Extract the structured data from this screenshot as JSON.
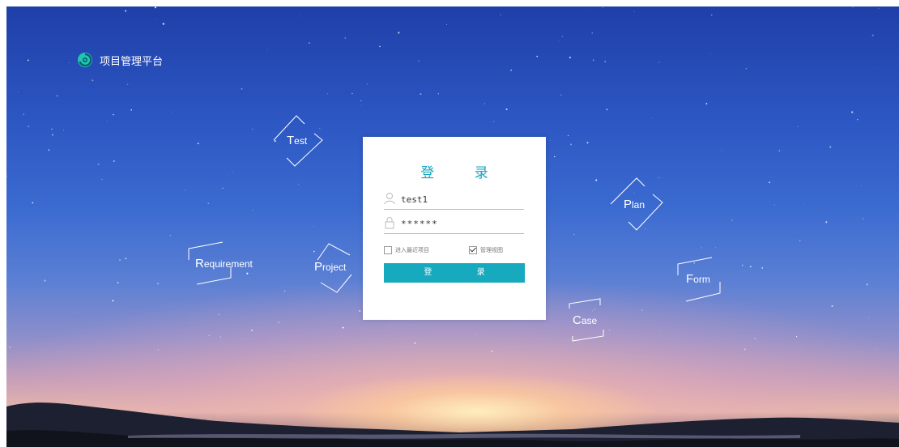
{
  "app": {
    "title": "项目管理平台"
  },
  "tags": {
    "test": {
      "first": "T",
      "rest": "est"
    },
    "requirement": {
      "first": "R",
      "rest": "equirement"
    },
    "project": {
      "first": "P",
      "rest": "roject"
    },
    "plan": {
      "first": "P",
      "rest": "lan"
    },
    "form": {
      "first": "F",
      "rest": "orm"
    },
    "case": {
      "first": "C",
      "rest": "ase"
    }
  },
  "login": {
    "title": "登 录",
    "username": "test1",
    "password": "******",
    "remember_recent_label": "进入最近项目",
    "remember_recent_checked": false,
    "admin_view_label": "管理视图",
    "admin_view_checked": true,
    "submit_label": "登 录"
  },
  "colors": {
    "accent": "#17a9bd",
    "title": "#17a5c0"
  }
}
